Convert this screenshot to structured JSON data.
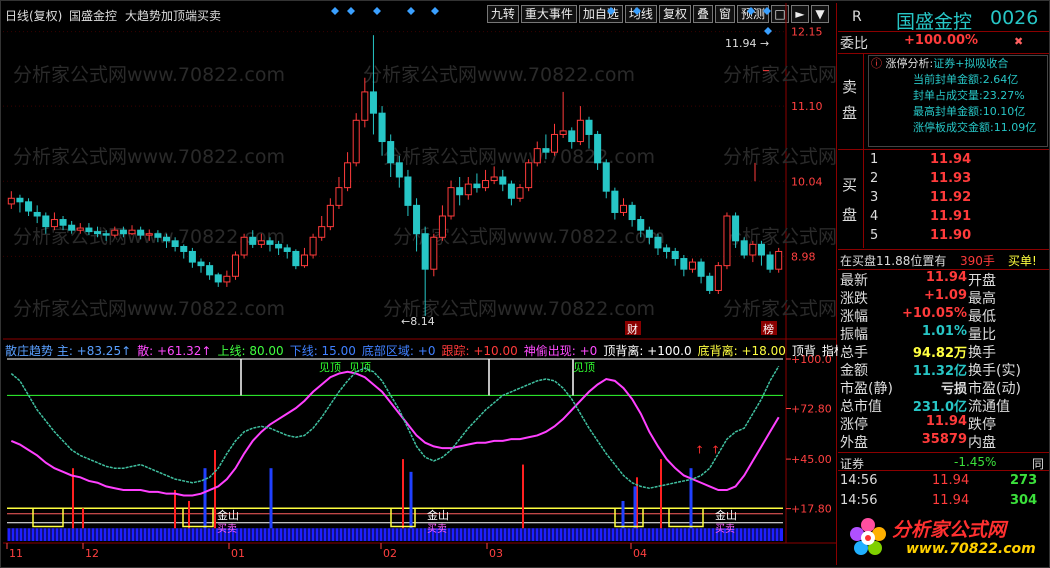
{
  "window": {
    "period": "日线(复权)",
    "stock_name": "国盛金控",
    "formula": "大趋势加顶端买卖"
  },
  "toolbar": [
    "九转",
    "重大事件",
    "加自选",
    "均线",
    "复权",
    "叠",
    "窗",
    "预测"
  ],
  "toolbar_icons": [
    "lock-icon",
    "play-icon",
    "dropdown-icon"
  ],
  "price_axis": [
    "12.15",
    "11.10",
    "10.04",
    "8.98"
  ],
  "price_annotations": {
    "high_label": "11.94",
    "low_label": "8.14",
    "marker_cai": "财",
    "marker_bang": "榜"
  },
  "watermark": "分析家公式网www.70822.com",
  "indicator_header": [
    {
      "text": "散庄趋势 主: +83.25↑",
      "color": "#5aa0ff"
    },
    {
      "text": "散: +61.32↑",
      "color": "#ff4cff"
    },
    {
      "text": "上线: 80.00",
      "color": "#40ff40"
    },
    {
      "text": "下线: 15.00",
      "color": "#4080ff"
    },
    {
      "text": "底部区域: +0",
      "color": "#4080ff"
    },
    {
      "text": "跟踪: +10.00",
      "color": "#ff3b3b"
    },
    {
      "text": "神偷出现: +0",
      "color": "#ff4cff"
    },
    {
      "text": "顶背离: +100.0",
      "color": "#ffffff"
    },
    {
      "text": "底背离: +18.00",
      "color": "#ffff40"
    },
    {
      "text": "顶背",
      "color": "#ffffff"
    },
    {
      "text": "指标说明",
      "color": "#ffffff"
    }
  ],
  "indicator_axis": [
    "100.0",
    "72.80",
    "45.00",
    "17.80"
  ],
  "indicator_labels": {
    "top": "见顶",
    "bottom": "金山",
    "sub": "买卖"
  },
  "date_axis": [
    "11",
    "12",
    "01",
    "02",
    "03",
    "04"
  ],
  "side": {
    "header": {
      "letter": "R",
      "title": "国盛金控",
      "code": "0026"
    },
    "weibi": {
      "label": "委比",
      "value": "+100.00%"
    },
    "limit_analysis": {
      "title": "涨停分析:",
      "tag": "证券+拟吸收合",
      "lines": [
        "当前封单金额:2.64亿",
        "封单占成交量:23.27%",
        "最高封单金额:10.10亿",
        "涨停板成交金额:11.09亿"
      ]
    },
    "sell_label": [
      "卖",
      "盘"
    ],
    "buy_label": [
      "买",
      "盘"
    ],
    "buy_levels": [
      {
        "n": "1",
        "price": "11.94"
      },
      {
        "n": "2",
        "price": "11.93"
      },
      {
        "n": "3",
        "price": "11.92"
      },
      {
        "n": "4",
        "price": "11.91"
      },
      {
        "n": "5",
        "price": "11.90"
      }
    ],
    "notice": {
      "text": "在买盘11.88位置有",
      "vol": "390手",
      "action": "买单!"
    },
    "stats": [
      {
        "k1": "最新",
        "v1": "11.94",
        "k2": "开盘",
        "c1": "red"
      },
      {
        "k1": "涨跌",
        "v1": "+1.09",
        "k2": "最高",
        "c1": "red"
      },
      {
        "k1": "涨幅",
        "v1": "+10.05%",
        "k2": "最低",
        "c1": "red"
      },
      {
        "k1": "振幅",
        "v1": "1.01%",
        "k2": "量比",
        "c1": "cyan"
      },
      {
        "k1": "总手",
        "v1": "94.82万",
        "k2": "换手",
        "c1": "yellow"
      },
      {
        "k1": "金额",
        "v1": "11.32亿",
        "k2": "换手(实)",
        "c1": "cyan"
      },
      {
        "k1": "市盈(静)",
        "v1": "亏损",
        "k2": "市盈(动)",
        "c1": "lbl"
      },
      {
        "k1": "总市值",
        "v1": "231.0亿",
        "k2": "流通值",
        "c1": "cyan"
      },
      {
        "k1": "涨停",
        "v1": "11.94",
        "k2": "跌停",
        "c1": "red"
      },
      {
        "k1": "外盘",
        "v1": "35879",
        "k2": "内盘",
        "c1": "red"
      }
    ],
    "sector": {
      "name": "证券",
      "change": "-1.45%",
      "extra": "同"
    },
    "ticks": [
      {
        "time": "14:56",
        "price": "11.94",
        "vol": "273"
      },
      {
        "time": "14:56",
        "price": "11.94",
        "vol": "304"
      }
    ],
    "logo": {
      "text": "分析家公式网",
      "url": "www.70822.com"
    }
  },
  "chart_data": {
    "type": "candlestick",
    "price_ylim": [
      7.9,
      12.3
    ],
    "candles": [
      [
        9.72,
        9.8,
        9.9,
        9.65
      ],
      [
        9.8,
        9.75,
        9.85,
        9.6
      ],
      [
        9.75,
        9.62,
        9.8,
        9.55
      ],
      [
        9.6,
        9.55,
        9.7,
        9.45
      ],
      [
        9.55,
        9.4,
        9.6,
        9.3
      ],
      [
        9.4,
        9.5,
        9.6,
        9.35
      ],
      [
        9.5,
        9.42,
        9.55,
        9.35
      ],
      [
        9.42,
        9.35,
        9.48,
        9.3
      ],
      [
        9.35,
        9.38,
        9.45,
        9.3
      ],
      [
        9.38,
        9.33,
        9.45,
        9.28
      ],
      [
        9.33,
        9.3,
        9.4,
        9.25
      ],
      [
        9.3,
        9.28,
        9.35,
        9.2
      ],
      [
        9.28,
        9.35,
        9.4,
        9.25
      ],
      [
        9.35,
        9.3,
        9.4,
        9.25
      ],
      [
        9.3,
        9.35,
        9.42,
        9.28
      ],
      [
        9.35,
        9.28,
        9.4,
        9.22
      ],
      [
        9.28,
        9.3,
        9.36,
        9.2
      ],
      [
        9.3,
        9.25,
        9.35,
        9.18
      ],
      [
        9.25,
        9.2,
        9.3,
        9.1
      ],
      [
        9.2,
        9.12,
        9.25,
        9.05
      ],
      [
        9.12,
        9.05,
        9.15,
        8.95
      ],
      [
        9.05,
        8.9,
        9.1,
        8.82
      ],
      [
        8.9,
        8.85,
        8.95,
        8.75
      ],
      [
        8.85,
        8.72,
        8.9,
        8.65
      ],
      [
        8.72,
        8.62,
        8.75,
        8.55
      ],
      [
        8.62,
        8.7,
        8.78,
        8.55
      ],
      [
        8.7,
        9.0,
        9.05,
        8.65
      ],
      [
        9.0,
        9.25,
        9.3,
        8.95
      ],
      [
        9.25,
        9.15,
        9.35,
        9.1
      ],
      [
        9.15,
        9.2,
        9.3,
        9.1
      ],
      [
        9.2,
        9.15,
        9.25,
        9.05
      ],
      [
        9.15,
        9.1,
        9.2,
        9.0
      ],
      [
        9.1,
        9.05,
        9.15,
        8.95
      ],
      [
        9.05,
        8.85,
        9.08,
        8.8
      ],
      [
        8.85,
        9.0,
        9.1,
        8.82
      ],
      [
        9.0,
        9.25,
        9.3,
        8.95
      ],
      [
        9.25,
        9.4,
        9.55,
        9.2
      ],
      [
        9.4,
        9.7,
        9.8,
        9.35
      ],
      [
        9.7,
        9.95,
        10.1,
        9.65
      ],
      [
        9.95,
        10.3,
        10.45,
        9.9
      ],
      [
        10.3,
        10.9,
        11.0,
        10.25
      ],
      [
        10.9,
        11.3,
        11.5,
        10.8
      ],
      [
        11.3,
        11.0,
        12.1,
        10.7
      ],
      [
        11.0,
        10.6,
        11.1,
        10.4
      ],
      [
        10.6,
        10.3,
        10.7,
        10.1
      ],
      [
        10.3,
        10.1,
        10.4,
        9.95
      ],
      [
        10.1,
        9.7,
        10.2,
        9.55
      ],
      [
        9.7,
        9.3,
        9.8,
        9.05
      ],
      [
        9.3,
        8.8,
        9.4,
        8.14
      ],
      [
        8.8,
        9.25,
        9.3,
        8.7
      ],
      [
        9.25,
        9.55,
        9.7,
        9.2
      ],
      [
        9.55,
        9.95,
        10.05,
        9.5
      ],
      [
        9.95,
        9.85,
        10.1,
        9.7
      ],
      [
        9.85,
        10.0,
        10.1,
        9.78
      ],
      [
        10.0,
        9.95,
        10.15,
        9.88
      ],
      [
        9.95,
        10.05,
        10.2,
        9.9
      ],
      [
        10.05,
        10.1,
        10.25,
        10.0
      ],
      [
        10.1,
        10.0,
        10.2,
        9.9
      ],
      [
        10.0,
        9.8,
        10.05,
        9.7
      ],
      [
        9.8,
        9.95,
        10.0,
        9.75
      ],
      [
        9.95,
        10.3,
        10.35,
        9.9
      ],
      [
        10.3,
        10.5,
        10.6,
        10.25
      ],
      [
        10.5,
        10.45,
        10.7,
        10.35
      ],
      [
        10.45,
        10.7,
        10.85,
        10.4
      ],
      [
        10.7,
        10.75,
        11.3,
        10.65
      ],
      [
        10.75,
        10.6,
        10.8,
        10.5
      ],
      [
        10.6,
        10.9,
        11.1,
        10.55
      ],
      [
        10.9,
        10.7,
        10.95,
        10.5
      ],
      [
        10.7,
        10.3,
        10.75,
        10.2
      ],
      [
        10.3,
        9.9,
        10.35,
        9.8
      ],
      [
        9.9,
        9.6,
        9.95,
        9.5
      ],
      [
        9.6,
        9.7,
        9.8,
        9.55
      ],
      [
        9.7,
        9.5,
        9.75,
        9.4
      ],
      [
        9.5,
        9.35,
        9.55,
        9.25
      ],
      [
        9.35,
        9.25,
        9.4,
        9.15
      ],
      [
        9.25,
        9.1,
        9.3,
        9.0
      ],
      [
        9.1,
        9.05,
        9.15,
        8.95
      ],
      [
        9.05,
        8.95,
        9.1,
        8.85
      ],
      [
        8.95,
        8.8,
        9.0,
        8.7
      ],
      [
        8.8,
        8.9,
        8.95,
        8.75
      ],
      [
        8.9,
        8.7,
        8.95,
        8.6
      ],
      [
        8.7,
        8.5,
        8.75,
        8.45
      ],
      [
        8.5,
        8.85,
        8.9,
        8.45
      ],
      [
        8.85,
        9.55,
        9.6,
        8.8
      ],
      [
        9.55,
        9.2,
        9.6,
        9.1
      ],
      [
        9.2,
        9.0,
        9.25,
        8.95
      ],
      [
        9.0,
        9.15,
        9.2,
        8.9
      ],
      [
        9.15,
        9.0,
        9.2,
        8.85
      ],
      [
        9.0,
        8.8,
        9.05,
        8.75
      ],
      [
        8.8,
        9.05,
        9.1,
        8.75
      ]
    ],
    "blue_diamonds_count": 9,
    "indicator_ylim": [
      0,
      100
    ],
    "indicator_series": {
      "main": [
        92,
        88,
        80,
        72,
        66,
        60,
        55,
        50,
        47,
        45,
        43,
        41,
        40,
        40,
        41,
        42,
        40,
        38,
        36,
        34,
        33,
        32,
        33,
        35,
        40,
        48,
        55,
        60,
        62,
        63,
        62,
        60,
        58,
        57,
        58,
        62,
        68,
        75,
        82,
        88,
        93,
        95,
        93,
        88,
        80,
        72,
        62,
        52,
        46,
        44,
        46,
        50,
        56,
        62,
        67,
        72,
        76,
        80,
        82,
        84,
        86,
        88,
        89,
        88,
        84,
        78,
        70,
        62,
        55,
        48,
        42,
        36,
        32,
        30,
        29,
        30,
        31,
        32,
        33,
        34,
        36,
        40,
        48,
        56,
        60,
        62,
        70,
        78,
        88,
        96
      ],
      "scatter": [
        55,
        53,
        50,
        47,
        43,
        40,
        38,
        36,
        35,
        33,
        32,
        30,
        29,
        28,
        28,
        28,
        27,
        27,
        26,
        26,
        25,
        25,
        26,
        28,
        30,
        34,
        40,
        48,
        55,
        60,
        64,
        67,
        70,
        73,
        77,
        82,
        86,
        90,
        92,
        93,
        92,
        90,
        86,
        82,
        76,
        70,
        64,
        58,
        54,
        52,
        51,
        51,
        52,
        53,
        54,
        54,
        55,
        55,
        56,
        56,
        57,
        58,
        60,
        63,
        67,
        72,
        77,
        82,
        86,
        89,
        88,
        84,
        78,
        70,
        60,
        52,
        45,
        40,
        36,
        34,
        32,
        30,
        28,
        28,
        30,
        36,
        44,
        52,
        60,
        68
      ]
    },
    "indicator_levels": {
      "upper": 80,
      "lower": 15,
      "yellow": 18
    }
  }
}
